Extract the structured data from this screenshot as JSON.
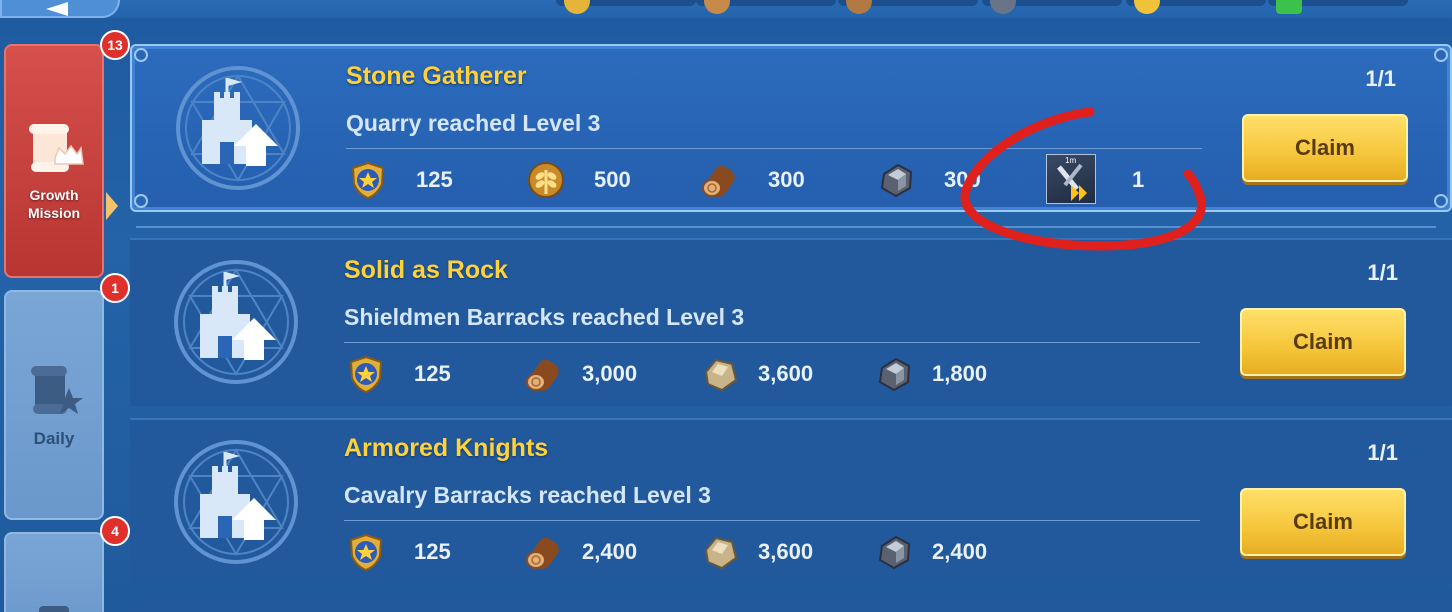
{
  "header": {
    "back_icon": "back-arrow-icon",
    "resource_icons": [
      "gold-laurel-icon",
      "wood-icon",
      "wood-icon",
      "iron-icon",
      "gold-coin-icon",
      "green-gem-icon"
    ]
  },
  "sidebar": {
    "tabs": [
      {
        "label": "Growth\nMission",
        "badge": "13",
        "icon": "scroll-crown-icon",
        "active": true
      },
      {
        "label": "Daily",
        "badge": "1",
        "icon": "scroll-star-icon",
        "active": false
      },
      {
        "label": "",
        "badge": "4",
        "icon": "scroll-icon",
        "active": false
      }
    ]
  },
  "missions": [
    {
      "title": "Stone Gatherer",
      "description": "Quarry reached Level 3",
      "progress": "1/1",
      "claim_label": "Claim",
      "highlighted": true,
      "rewards": [
        {
          "icon": "exp-medal-icon",
          "value": "125"
        },
        {
          "icon": "wheat-icon",
          "value": "500"
        },
        {
          "icon": "wood-log-icon",
          "value": "300"
        },
        {
          "icon": "iron-ore-icon",
          "value": "300"
        },
        {
          "icon": "speedup-item-icon",
          "value": "1",
          "item_tag": "1m"
        }
      ]
    },
    {
      "title": "Solid as Rock",
      "description": "Shieldmen Barracks reached Level 3",
      "progress": "1/1",
      "claim_label": "Claim",
      "highlighted": false,
      "rewards": [
        {
          "icon": "exp-medal-icon",
          "value": "125"
        },
        {
          "icon": "wood-log-icon",
          "value": "3,000"
        },
        {
          "icon": "stone-icon",
          "value": "3,600"
        },
        {
          "icon": "iron-ore-icon",
          "value": "1,800"
        }
      ]
    },
    {
      "title": "Armored Knights",
      "description": "Cavalry Barracks reached Level 3",
      "progress": "1/1",
      "claim_label": "Claim",
      "highlighted": false,
      "rewards": [
        {
          "icon": "exp-medal-icon",
          "value": "125"
        },
        {
          "icon": "wood-log-icon",
          "value": "2,400"
        },
        {
          "icon": "stone-icon",
          "value": "3,600"
        },
        {
          "icon": "iron-ore-icon",
          "value": "2,400"
        }
      ]
    }
  ],
  "annotation": {
    "shape": "red-circle-marker",
    "color": "#e0201c"
  },
  "colors": {
    "title": "#ffd23c",
    "claim_button": "#f5c53a",
    "badge": "#e0302c",
    "active_tab": "#c9413e"
  }
}
